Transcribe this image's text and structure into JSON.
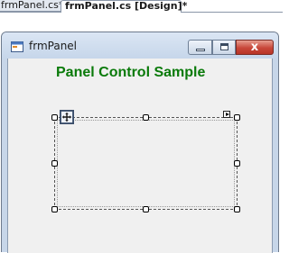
{
  "tabs": [
    {
      "label": "frmPanel.cs*"
    },
    {
      "label": "frmPanel.cs [Design]*"
    }
  ],
  "window": {
    "title": "frmPanel",
    "close_label": "x"
  },
  "form": {
    "heading": "Panel Control Sample",
    "heading_color": "#0a7a0a"
  },
  "icons": {
    "app": "form-icon",
    "move": "move-icon",
    "smart_tag": "smart-tag-icon"
  }
}
